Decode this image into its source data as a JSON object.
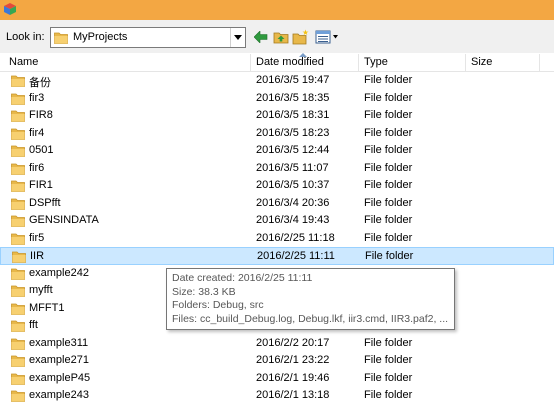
{
  "toolbar": {
    "look_in_label": "Look in:",
    "look_in_value": "MyProjects"
  },
  "columns": {
    "name": "Name",
    "date": "Date modified",
    "type": "Type",
    "size": "Size"
  },
  "rows": [
    {
      "name": "备份",
      "date": "2016/3/5 19:47",
      "type": "File folder"
    },
    {
      "name": "fir3",
      "date": "2016/3/5 18:35",
      "type": "File folder"
    },
    {
      "name": "FIR8",
      "date": "2016/3/5 18:31",
      "type": "File folder"
    },
    {
      "name": "fir4",
      "date": "2016/3/5 18:23",
      "type": "File folder"
    },
    {
      "name": "0501",
      "date": "2016/3/5 12:44",
      "type": "File folder"
    },
    {
      "name": "fir6",
      "date": "2016/3/5 11:07",
      "type": "File folder"
    },
    {
      "name": "FIR1",
      "date": "2016/3/5 10:37",
      "type": "File folder"
    },
    {
      "name": "DSPfft",
      "date": "2016/3/4 20:36",
      "type": "File folder"
    },
    {
      "name": "GENSINDATA",
      "date": "2016/3/4 19:43",
      "type": "File folder"
    },
    {
      "name": "fir5",
      "date": "2016/2/25 11:18",
      "type": "File folder"
    },
    {
      "name": "IIR",
      "date": "2016/2/25 11:11",
      "type": "File folder"
    },
    {
      "name": "example242",
      "date": "",
      "type": ""
    },
    {
      "name": "myfft",
      "date": "",
      "type": ""
    },
    {
      "name": "MFFT1",
      "date": "",
      "type": ""
    },
    {
      "name": "fft",
      "date": "",
      "type": ""
    },
    {
      "name": "example311",
      "date": "2016/2/2 20:17",
      "type": "File folder"
    },
    {
      "name": "example271",
      "date": "2016/2/1 23:22",
      "type": "File folder"
    },
    {
      "name": "exampleP45",
      "date": "2016/2/1 19:46",
      "type": "File folder"
    },
    {
      "name": "example243",
      "date": "2016/2/1 13:18",
      "type": "File folder"
    }
  ],
  "selected_index": 10,
  "tooltip": {
    "created": "Date created: 2016/2/25 11:11",
    "size": "Size: 38.3 KB",
    "folders": "Folders: Debug, src",
    "files": "Files: cc_build_Debug.log, Debug.lkf, iir3.cmd, IIR3.paf2, ..."
  },
  "colors": {
    "titlebar": "#f3a743",
    "selection": "#cce8ff",
    "selection_border": "#99d1ff",
    "folder": "#e8b84a"
  },
  "icons": [
    "app-icon",
    "folder-icon",
    "back-arrow-icon",
    "up-folder-icon",
    "new-folder-icon",
    "view-menu-icon",
    "chevron-down-icon"
  ]
}
